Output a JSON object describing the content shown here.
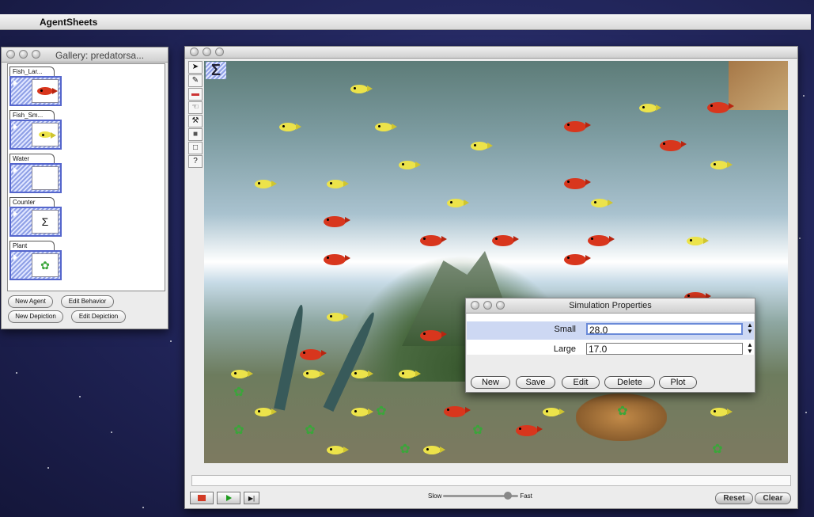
{
  "menubar": {
    "apple_icon": "apple-icon",
    "app_name": "AgentSheets"
  },
  "gallery": {
    "title": "Gallery: predatorsa...",
    "agents": [
      {
        "name": "Fish_Lar...",
        "icon": "red-fish-icon"
      },
      {
        "name": "Fish_Sm...",
        "icon": "yellow-fish-icon"
      },
      {
        "name": "Water",
        "icon": "water-icon"
      },
      {
        "name": "Counter",
        "icon": "sigma-icon"
      },
      {
        "name": "Plant",
        "icon": "plant-icon"
      }
    ],
    "buttons": {
      "new_agent": "New Agent",
      "edit_behavior": "Edit Behavior",
      "new_depiction": "New Depiction",
      "edit_depiction": "Edit Depiction"
    }
  },
  "main": {
    "tools": [
      "arrow-tool",
      "pencil-tool",
      "eraser-tool",
      "hand-tool",
      "hammer-tool",
      "rectangle-tool",
      "empty-rectangle-tool",
      "help-tool"
    ],
    "tool_help_glyph": "?",
    "controls": {
      "slow": "Slow",
      "fast": "Fast",
      "speed_level": 0.9,
      "reset": "Reset",
      "clear": "Clear"
    }
  },
  "simulation_properties": {
    "title": "Simulation Properties",
    "rows": [
      {
        "label": "Small",
        "value": "28.0"
      },
      {
        "label": "Large",
        "value": "17.0"
      }
    ],
    "buttons": {
      "new": "New",
      "save": "Save",
      "edit": "Edit",
      "delete": "Delete",
      "plot": "Plot"
    }
  },
  "colors": {
    "big_fish": "#d8361d",
    "small_fish": "#ece34a",
    "selection": "#6a8ad8"
  }
}
